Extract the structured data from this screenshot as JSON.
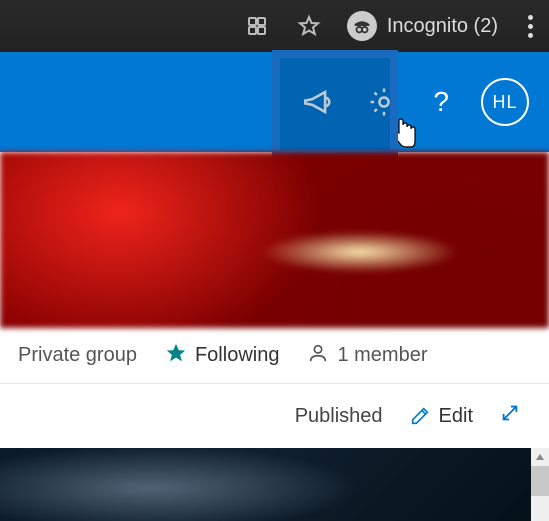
{
  "browser": {
    "incognito_label": "Incognito (2)"
  },
  "header": {
    "avatar_initials": "HL",
    "help_symbol": "?"
  },
  "info": {
    "privacy_label": "Private group",
    "following_label": "Following",
    "member_count_label": "1 member"
  },
  "actions": {
    "published_label": "Published",
    "edit_label": "Edit"
  }
}
